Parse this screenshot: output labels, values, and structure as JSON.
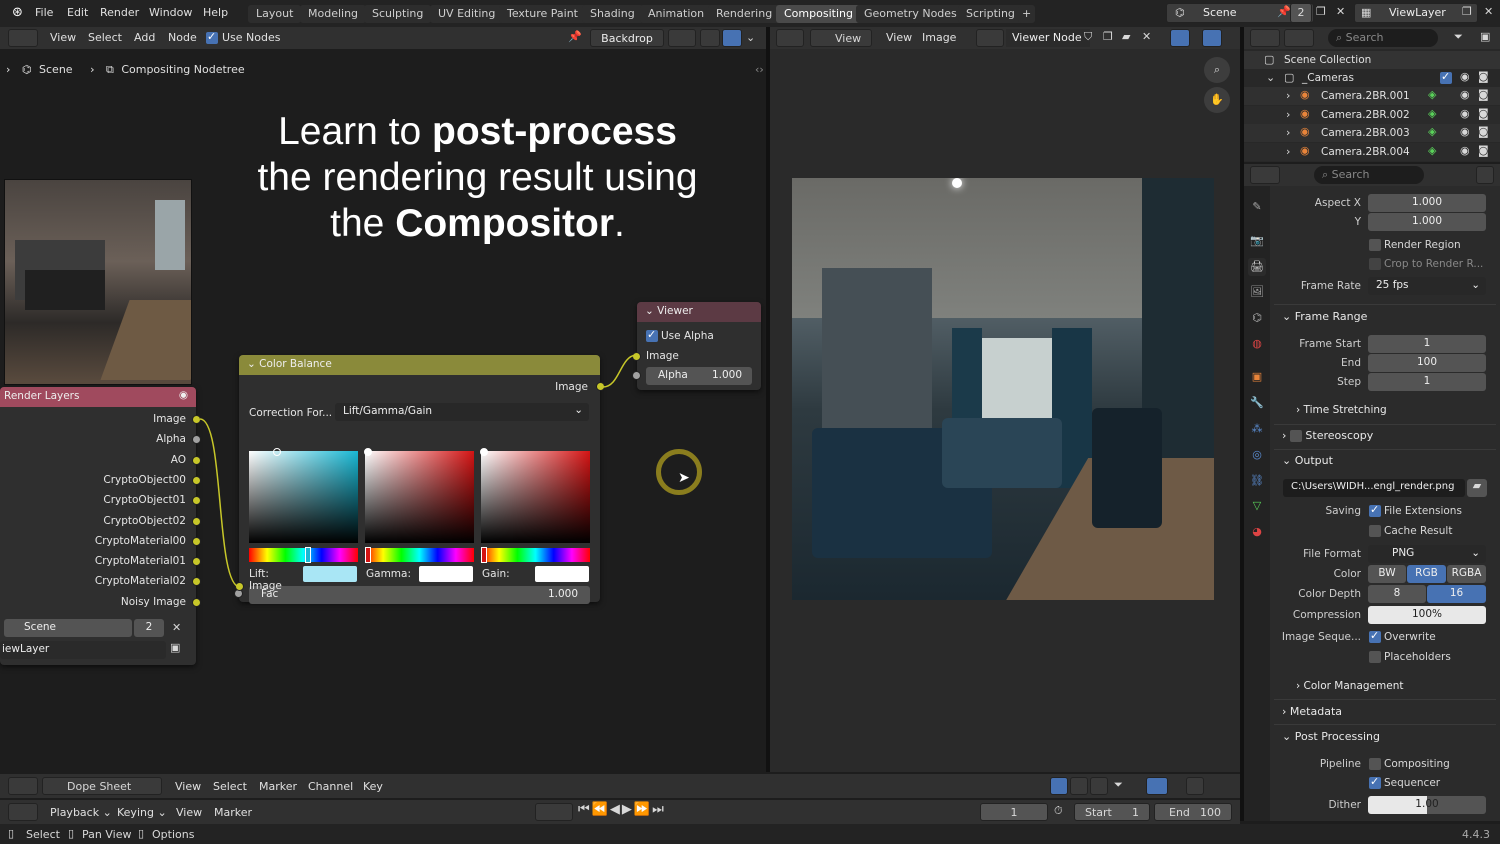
{
  "topbar": {
    "menus": [
      "File",
      "Edit",
      "Render",
      "Window",
      "Help"
    ],
    "workspaces": [
      "Layout",
      "Modeling",
      "Sculpting",
      "UV Editing",
      "Texture Paint",
      "Shading",
      "Animation",
      "Rendering",
      "Compositing",
      "Geometry Nodes",
      "Scripting"
    ],
    "active_workspace": "Compositing",
    "scene": "Scene",
    "scene_count": "2",
    "view_layer": "ViewLayer"
  },
  "node_editor": {
    "menus": [
      "View",
      "Select",
      "Add",
      "Node"
    ],
    "use_nodes_label": "Use Nodes",
    "backdrop_label": "Backdrop",
    "breadcrumb": [
      "Scene",
      "Compositing Nodetree"
    ],
    "overlay_title": {
      "l1a": "Learn to ",
      "l1b": "post-process",
      "l2": "the rendering result using",
      "l3a": "the ",
      "l3b": "Compositor",
      "l3c": "."
    },
    "render_layers": {
      "title": "Render Layers",
      "outputs": [
        "Image",
        "Alpha",
        "AO",
        "CryptoObject00",
        "CryptoObject01",
        "CryptoObject02",
        "CryptoMaterial00",
        "CryptoMaterial01",
        "CryptoMaterial02",
        "Noisy Image"
      ],
      "scene": "Scene",
      "scene_num": "2",
      "layer": "iewLayer"
    },
    "color_balance": {
      "title": "Color Balance",
      "output": "Image",
      "correction_label": "Correction For...",
      "correction_value": "Lift/Gamma/Gain",
      "lift": "Lift:",
      "gamma": "Gamma:",
      "gain": "Gain:",
      "fac_label": "Fac",
      "fac_value": "1.000",
      "input": "Image"
    },
    "viewer": {
      "title": "Viewer",
      "use_alpha": "Use Alpha",
      "input": "Image",
      "alpha_label": "Alpha",
      "alpha_value": "1.000"
    }
  },
  "image_editor": {
    "menus": [
      "View",
      "View",
      "Image"
    ],
    "viewer_node": "Viewer Node"
  },
  "outliner": {
    "search": "Search",
    "collection": "Scene Collection",
    "cameras": "_Cameras",
    "items": [
      "Camera.2BR.001",
      "Camera.2BR.002",
      "Camera.2BR.003",
      "Camera.2BR.004"
    ]
  },
  "properties": {
    "search": "Search",
    "aspect_x_label": "Aspect X",
    "aspect_x": "1.000",
    "aspect_y_label": "Y",
    "aspect_y": "1.000",
    "render_region": "Render Region",
    "crop": "Crop to Render R...",
    "frame_rate_label": "Frame Rate",
    "frame_rate": "25 fps",
    "frame_range": "Frame Range",
    "frame_start_label": "Frame Start",
    "frame_start": "1",
    "end_label": "End",
    "end": "100",
    "step_label": "Step",
    "step": "1",
    "time_stretching": "Time Stretching",
    "stereoscopy": "Stereoscopy",
    "output": "Output",
    "path": "C:\\Users\\WIDH...engl_render.png",
    "saving_label": "Saving",
    "file_ext": "File Extensions",
    "cache": "Cache Result",
    "file_format_label": "File Format",
    "file_format": "PNG",
    "color_label": "Color",
    "color_opts": [
      "BW",
      "RGB",
      "RGBA"
    ],
    "depth_label": "Color Depth",
    "depth_opts": [
      "8",
      "16"
    ],
    "compression_label": "Compression",
    "compression": "100%",
    "image_seq_label": "Image Seque...",
    "overwrite": "Overwrite",
    "placeholders": "Placeholders",
    "color_mgmt": "Color Management",
    "metadata": "Metadata",
    "post_processing": "Post Processing",
    "pipeline_label": "Pipeline",
    "compositing": "Compositing",
    "sequencer": "Sequencer",
    "dither_label": "Dither",
    "dither": "1.00"
  },
  "dopesheet": {
    "mode": "Dope Sheet",
    "menus": [
      "View",
      "Select",
      "Marker",
      "Channel",
      "Key"
    ]
  },
  "timeline": {
    "playback": "Playback",
    "keying": "Keying",
    "menus": [
      "View",
      "Marker"
    ],
    "current": "1",
    "start_label": "Start",
    "start": "1",
    "end_label": "End",
    "end": "100"
  },
  "statusbar": {
    "select": "Select",
    "pan": "Pan View",
    "options": "Options",
    "version": "4.4.3"
  }
}
